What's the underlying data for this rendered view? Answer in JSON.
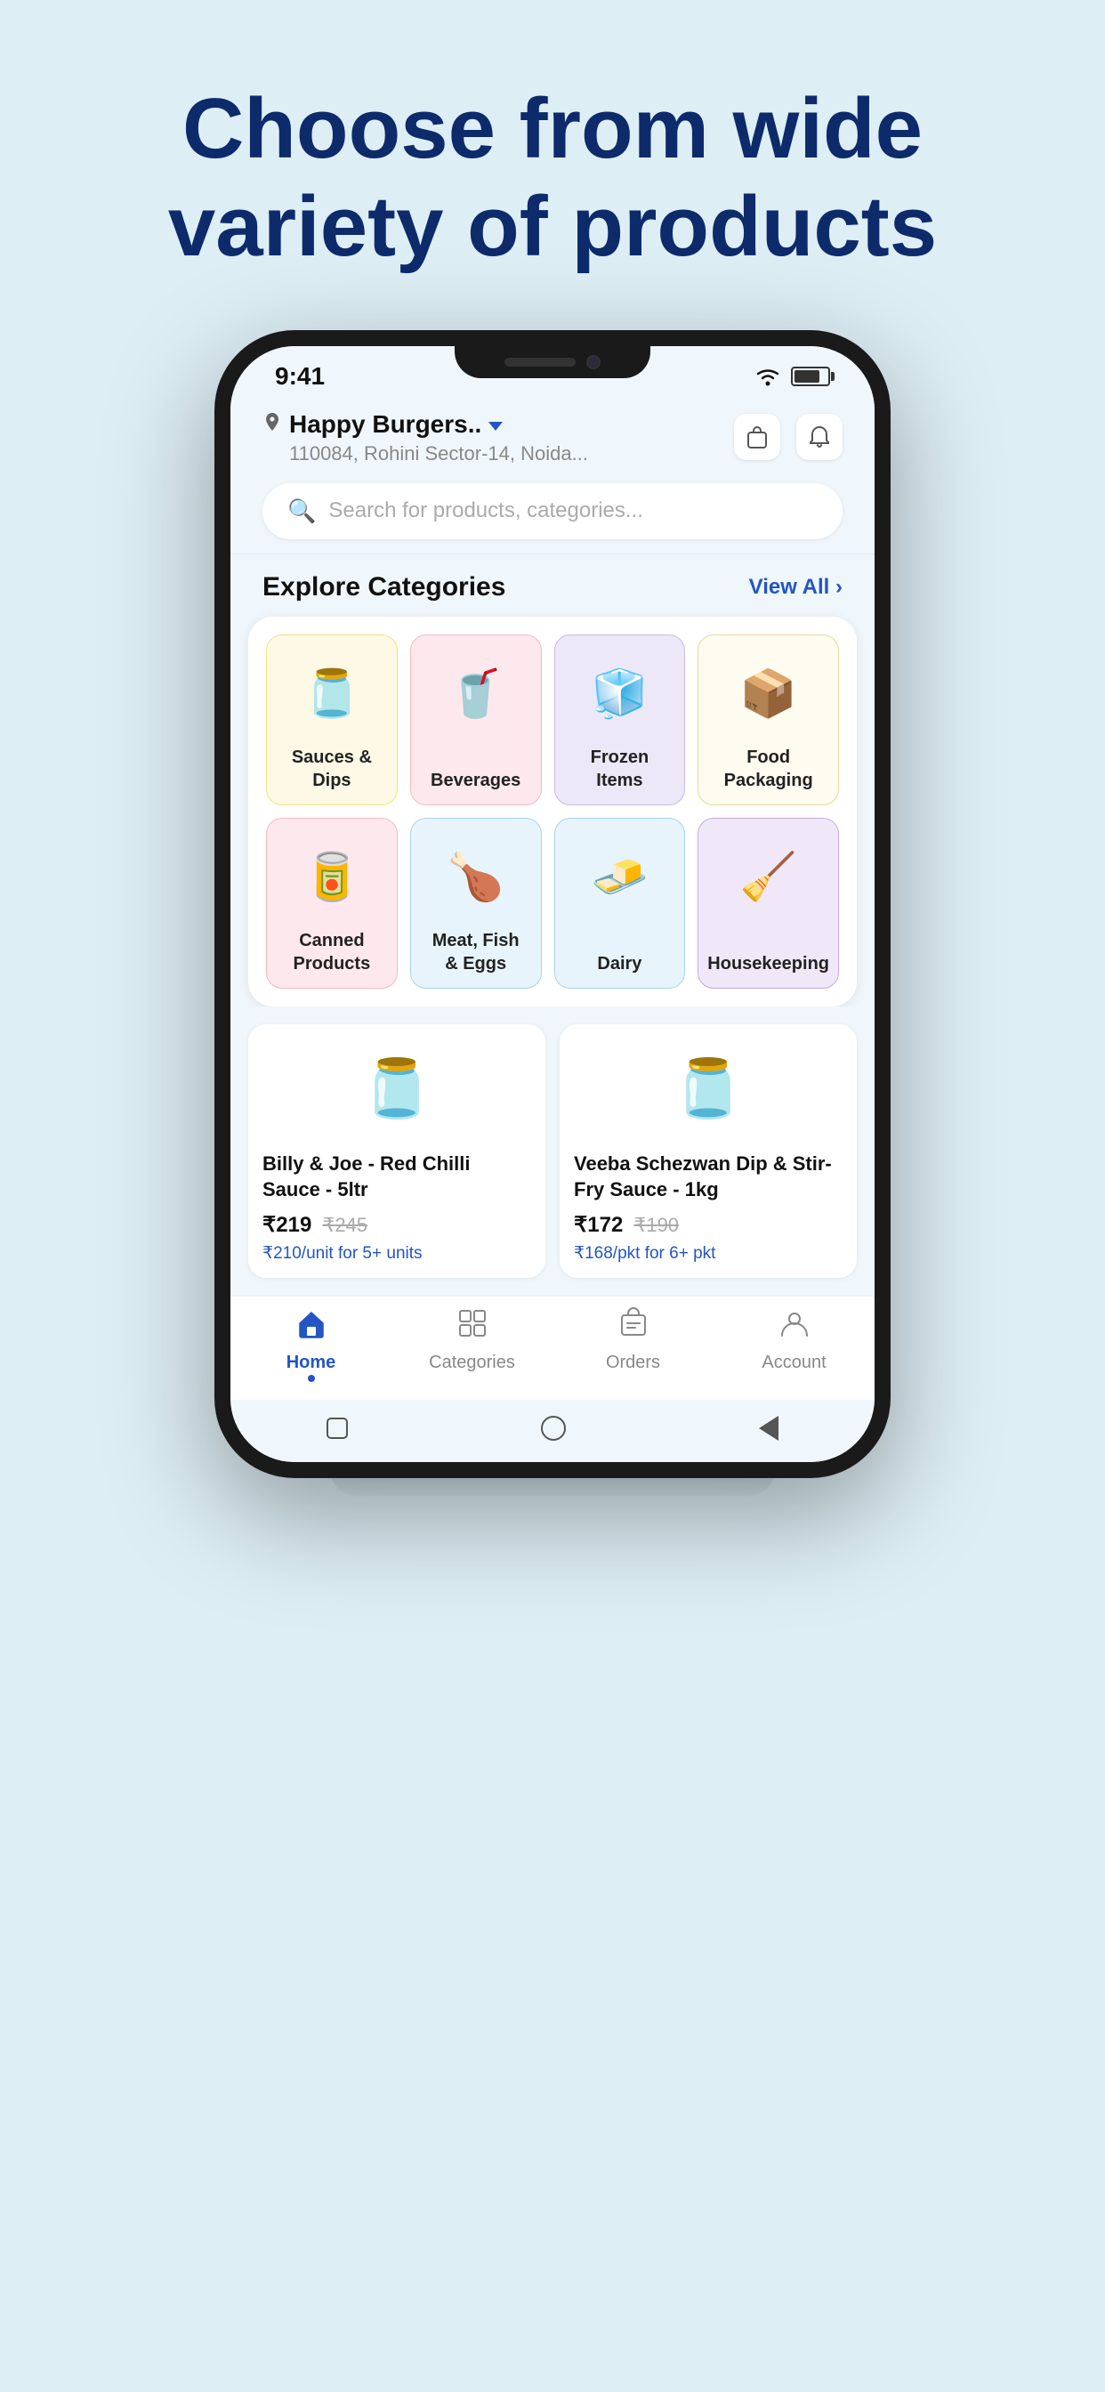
{
  "headline": {
    "line1": "Choose from wide",
    "line2": "variety of products"
  },
  "status_bar": {
    "time": "9:41",
    "wifi": "wifi",
    "battery": "battery"
  },
  "app_header": {
    "location_name": "Happy Burgers.. ▾",
    "location_name_text": "Happy Burgers..",
    "location_address": "110084, Rohini Sector-14, Noida...",
    "icon_orders": "🛍",
    "icon_bell": "🔔"
  },
  "search": {
    "placeholder": "Search for products, categories..."
  },
  "explore": {
    "title": "Explore Categories",
    "view_all": "View All ›"
  },
  "categories": [
    {
      "id": "sauces",
      "label": "Sauces &\nDips",
      "emoji": "🫙",
      "style": "cat-yellow"
    },
    {
      "id": "beverages",
      "label": "Beverages",
      "emoji": "🥤",
      "style": "cat-pink"
    },
    {
      "id": "frozen",
      "label": "Frozen\nItems",
      "emoji": "🧊",
      "style": "cat-lavender"
    },
    {
      "id": "food-packaging",
      "label": "Food\nPackaging",
      "emoji": "📦",
      "style": "cat-cream"
    },
    {
      "id": "canned",
      "label": "Canned\nProducts",
      "emoji": "🥫",
      "style": "cat-pinklight"
    },
    {
      "id": "meat-fish",
      "label": "Meat, Fish\n& Eggs",
      "emoji": "🍗",
      "style": "cat-lightblue"
    },
    {
      "id": "dairy",
      "label": "Dairy",
      "emoji": "🧈",
      "style": "cat-paleblue"
    },
    {
      "id": "housekeeping",
      "label": "Housekeeping",
      "emoji": "🧹",
      "style": "cat-lightpurple"
    }
  ],
  "products": [
    {
      "id": "p1",
      "name": "Billy & Joe - Red Chilli Sauce - 5ltr",
      "emoji": "🫙",
      "price_current": "219",
      "price_original": "245",
      "bulk_price": "₹210/unit for 5+ units"
    },
    {
      "id": "p2",
      "name": "Veeba Schezwan Dip & Stir-Fry Sauce - 1kg",
      "emoji": "🫙",
      "price_current": "172",
      "price_original": "190",
      "bulk_price": "₹168/pkt for 6+ pkt"
    }
  ],
  "bottom_nav": [
    {
      "id": "home",
      "label": "Home",
      "icon": "🏠",
      "active": true
    },
    {
      "id": "categories",
      "label": "Categories",
      "icon": "⊞",
      "active": false
    },
    {
      "id": "orders",
      "label": "Orders",
      "icon": "🛒",
      "active": false
    },
    {
      "id": "account",
      "label": "Account",
      "icon": "👤",
      "active": false
    }
  ]
}
